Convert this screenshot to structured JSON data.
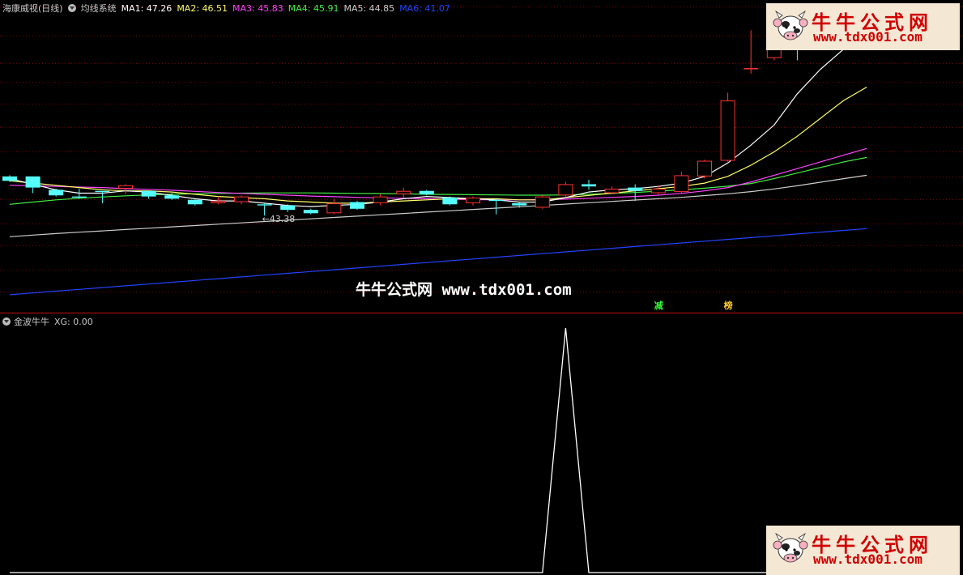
{
  "main_header": {
    "stock": "海康威视(日线)",
    "indicator": "均线系统",
    "ma_values": [
      {
        "label": "MA1: 47.26",
        "color": "#ffffff"
      },
      {
        "label": "MA2: 46.51",
        "color": "#ffff66"
      },
      {
        "label": "MA3: 45.83",
        "color": "#ff44ff"
      },
      {
        "label": "MA4: 45.91",
        "color": "#44ee44"
      },
      {
        "label": "MA5: 44.85",
        "color": "#cccccc"
      },
      {
        "label": "MA6: 41.07",
        "color": "#2244ff"
      }
    ]
  },
  "low_annotation": "←43.38",
  "watermark_text": "牛牛公式网 www.tdx001.com",
  "logo": {
    "title": "牛牛公式网",
    "url": "www.tdx001.com"
  },
  "signals": [
    {
      "text": "减",
      "color": "#33ff33"
    },
    {
      "text": "榜",
      "color": "#ffcc33"
    }
  ],
  "indicator_panel": {
    "name": "金波牛牛",
    "value_label": "XG: 0.00"
  },
  "colors": {
    "up": "#ff3333",
    "down": "#55ffff",
    "ma1": "#ffffff",
    "ma2": "#ffff66",
    "ma3": "#ff44ff",
    "ma4": "#44ee44",
    "ma5": "#cccccc",
    "ma6": "#2244ff",
    "grid": "#7a0000",
    "separator": "#c01010"
  },
  "chart_data": {
    "type": "candlestick",
    "price_range": [
      38.5,
      52.5
    ],
    "candles": [
      {
        "o": 44.6,
        "h": 44.65,
        "l": 44.35,
        "c": 44.4
      },
      {
        "o": 44.6,
        "h": 44.6,
        "l": 43.85,
        "c": 44.1
      },
      {
        "o": 44.0,
        "h": 44.05,
        "l": 43.7,
        "c": 43.75
      },
      {
        "o": 43.7,
        "h": 44.05,
        "l": 43.6,
        "c": 43.65
      },
      {
        "o": 43.95,
        "h": 43.95,
        "l": 43.4,
        "c": 43.9
      },
      {
        "o": 44.05,
        "h": 44.25,
        "l": 43.8,
        "c": 44.2
      },
      {
        "o": 43.95,
        "h": 43.95,
        "l": 43.6,
        "c": 43.7
      },
      {
        "o": 43.75,
        "h": 43.85,
        "l": 43.55,
        "c": 43.6
      },
      {
        "o": 43.55,
        "h": 43.6,
        "l": 43.3,
        "c": 43.35
      },
      {
        "o": 43.4,
        "h": 43.7,
        "l": 43.35,
        "c": 43.5
      },
      {
        "o": 43.45,
        "h": 43.75,
        "l": 43.35,
        "c": 43.7
      },
      {
        "o": 43.35,
        "h": 43.4,
        "l": 42.85,
        "c": 43.3
      },
      {
        "o": 43.3,
        "h": 43.35,
        "l": 43.0,
        "c": 43.1
      },
      {
        "o": 43.1,
        "h": 43.15,
        "l": 42.9,
        "c": 42.95
      },
      {
        "o": 42.95,
        "h": 43.6,
        "l": 42.9,
        "c": 43.4
      },
      {
        "o": 43.45,
        "h": 43.5,
        "l": 43.1,
        "c": 43.15
      },
      {
        "o": 43.4,
        "h": 43.8,
        "l": 43.3,
        "c": 43.7
      },
      {
        "o": 43.8,
        "h": 44.1,
        "l": 43.65,
        "c": 43.95
      },
      {
        "o": 43.95,
        "h": 44.0,
        "l": 43.75,
        "c": 43.8
      },
      {
        "o": 43.65,
        "h": 43.7,
        "l": 43.3,
        "c": 43.35
      },
      {
        "o": 43.4,
        "h": 43.7,
        "l": 43.3,
        "c": 43.65
      },
      {
        "o": 43.55,
        "h": 43.6,
        "l": 42.9,
        "c": 43.5
      },
      {
        "o": 43.4,
        "h": 43.45,
        "l": 43.2,
        "c": 43.3
      },
      {
        "o": 43.2,
        "h": 43.75,
        "l": 43.15,
        "c": 43.7
      },
      {
        "o": 43.75,
        "h": 44.35,
        "l": 43.7,
        "c": 44.25
      },
      {
        "o": 44.25,
        "h": 44.45,
        "l": 44.0,
        "c": 44.15
      },
      {
        "o": 43.85,
        "h": 44.15,
        "l": 43.8,
        "c": 44.05
      },
      {
        "o": 44.1,
        "h": 44.25,
        "l": 43.5,
        "c": 43.95
      },
      {
        "o": 43.85,
        "h": 44.2,
        "l": 43.8,
        "c": 44.05
      },
      {
        "o": 43.9,
        "h": 44.8,
        "l": 43.85,
        "c": 44.65
      },
      {
        "o": 44.6,
        "h": 45.35,
        "l": 44.5,
        "c": 45.3
      },
      {
        "o": 45.3,
        "h": 48.35,
        "l": 45.25,
        "c": 48.0
      },
      {
        "o": 49.4,
        "h": 51.15,
        "l": 49.2,
        "c": 49.45
      },
      {
        "o": 49.9,
        "h": 51.15,
        "l": 49.8,
        "c": 51.05
      },
      {
        "o": 50.9,
        "h": 50.95,
        "l": 49.8,
        "c": 50.6
      },
      {
        "o": 50.7,
        "h": 51.6,
        "l": 50.65,
        "c": 51.5
      },
      {
        "o": 51.2,
        "h": 51.3,
        "l": 50.45,
        "c": 50.5
      },
      {
        "o": 50.6,
        "h": 51.2,
        "l": 50.45,
        "c": 51.15
      }
    ],
    "ma1": [
      44.5,
      44.25,
      44.0,
      43.85,
      43.85,
      43.95,
      43.9,
      43.75,
      43.6,
      43.5,
      43.5,
      43.4,
      43.3,
      43.25,
      43.3,
      43.35,
      43.45,
      43.6,
      43.7,
      43.65,
      43.6,
      43.55,
      43.45,
      43.45,
      43.65,
      43.9,
      44.0,
      44.05,
      44.15,
      44.3,
      44.6,
      45.2,
      46.0,
      46.9,
      48.3,
      49.4,
      50.3,
      50.9
    ],
    "ma2": [
      44.4,
      44.3,
      44.2,
      44.1,
      44.0,
      43.95,
      43.95,
      43.9,
      43.8,
      43.7,
      43.65,
      43.6,
      43.5,
      43.45,
      43.4,
      43.4,
      43.45,
      43.5,
      43.55,
      43.6,
      43.6,
      43.6,
      43.55,
      43.55,
      43.65,
      43.75,
      43.85,
      43.95,
      44.05,
      44.15,
      44.3,
      44.6,
      45.1,
      45.7,
      46.4,
      47.2,
      48.0,
      48.6
    ],
    "ma3": [
      44.2,
      44.18,
      44.15,
      44.12,
      44.1,
      44.05,
      44.02,
      43.98,
      43.93,
      43.88,
      43.84,
      43.8,
      43.76,
      43.72,
      43.69,
      43.66,
      43.64,
      43.62,
      43.6,
      43.58,
      43.56,
      43.55,
      43.55,
      43.56,
      43.58,
      43.62,
      43.66,
      43.7,
      43.76,
      43.84,
      43.95,
      44.1,
      44.35,
      44.65,
      44.95,
      45.25,
      45.55,
      45.85
    ],
    "ma4": [
      43.35,
      43.45,
      43.55,
      43.62,
      43.68,
      43.73,
      43.77,
      43.8,
      43.82,
      43.84,
      43.85,
      43.86,
      43.86,
      43.86,
      43.85,
      43.84,
      43.83,
      43.82,
      43.8,
      43.79,
      43.78,
      43.77,
      43.76,
      43.76,
      43.77,
      43.8,
      43.84,
      43.88,
      43.94,
      44.0,
      44.07,
      44.16,
      44.28,
      44.5,
      44.75,
      45.0,
      45.25,
      45.45
    ],
    "ma5": [
      41.9,
      41.97,
      42.04,
      42.1,
      42.16,
      42.22,
      42.28,
      42.34,
      42.4,
      42.46,
      42.52,
      42.58,
      42.64,
      42.7,
      42.76,
      42.82,
      42.88,
      42.94,
      43.0,
      43.06,
      43.12,
      43.18,
      43.24,
      43.3,
      43.36,
      43.42,
      43.48,
      43.54,
      43.6,
      43.66,
      43.74,
      43.82,
      43.92,
      44.04,
      44.18,
      44.34,
      44.5,
      44.65
    ],
    "ma6": [
      39.3,
      39.38,
      39.46,
      39.54,
      39.62,
      39.7,
      39.78,
      39.86,
      39.94,
      40.02,
      40.1,
      40.18,
      40.26,
      40.34,
      40.42,
      40.5,
      40.58,
      40.66,
      40.74,
      40.82,
      40.9,
      40.98,
      41.06,
      41.14,
      41.22,
      41.3,
      41.38,
      41.46,
      41.54,
      41.62,
      41.7,
      41.78,
      41.86,
      41.94,
      42.02,
      42.1,
      42.18,
      42.26
    ],
    "indicator_xg": [
      0,
      0,
      0,
      0,
      0,
      0,
      0,
      0,
      0,
      0,
      0,
      0,
      0,
      0,
      0,
      0,
      0,
      0,
      0,
      0,
      0,
      0,
      0,
      0,
      1,
      0,
      0,
      0,
      0,
      0,
      0,
      0,
      0,
      0,
      0,
      0,
      0,
      0
    ],
    "indicator_range": [
      0,
      1
    ]
  }
}
